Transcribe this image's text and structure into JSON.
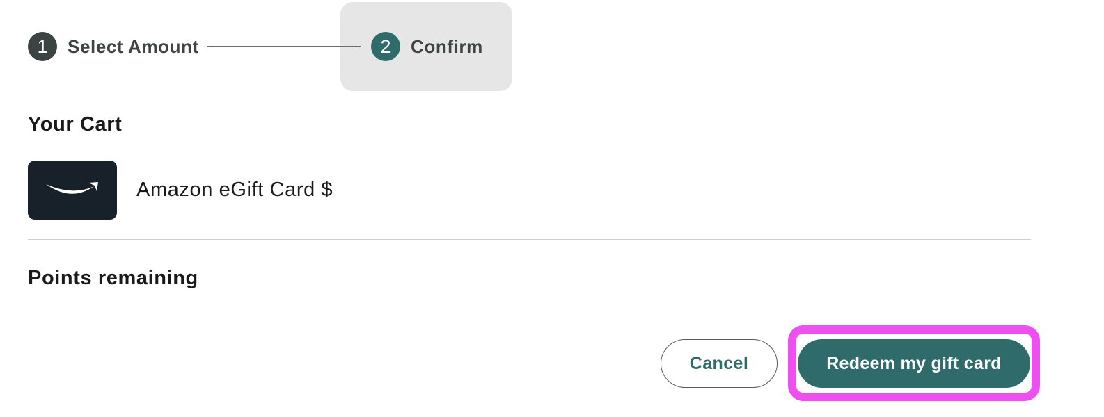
{
  "stepper": {
    "steps": [
      {
        "number": "1",
        "label": "Select Amount",
        "state": "completed"
      },
      {
        "number": "2",
        "label": "Confirm",
        "state": "active"
      }
    ]
  },
  "cart": {
    "title": "Your Cart",
    "item": {
      "name": "Amazon eGift Card $",
      "icon": "amazon-smile-logo"
    }
  },
  "points": {
    "title": "Points remaining"
  },
  "actions": {
    "cancel_label": "Cancel",
    "redeem_label": "Redeem my gift card"
  },
  "colors": {
    "accent": "#2f6b6a",
    "step_completed": "#3b4343",
    "highlight": "#ee4ff0",
    "thumb_bg": "#18202a"
  }
}
